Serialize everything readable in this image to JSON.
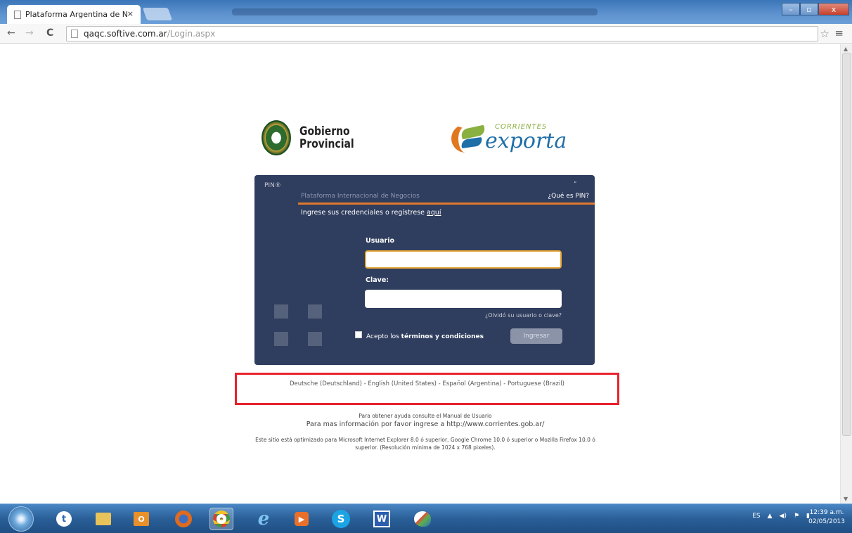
{
  "browser": {
    "tab_title": "Plataforma Argentina de N",
    "tab_close": "×",
    "url_host": "qaqc.softive.com.ar",
    "url_path": "/Login.aspx",
    "back_icon": "←",
    "forward_icon": "→",
    "reload_icon": "C",
    "star_icon": "☆",
    "menu_icon": "≡",
    "win_minimize": "–",
    "win_maximize": "▫",
    "win_close": "x"
  },
  "header": {
    "gobierno_line1": "Gobierno",
    "gobierno_line2": "Provincial",
    "corrientes_small": "CORRIENTES",
    "corrientes_big": "exporta",
    "brand_colors": {
      "orange": "#e07820",
      "green": "#8ab040",
      "blue": "#1e6ea8"
    }
  },
  "login": {
    "pin_label": "PIN®",
    "corner_mark": "\"",
    "platform_name": "Plataforma Internacional de Negocios",
    "what_is_pin": "¿Qué es PIN?",
    "intro_text": "Ingrese sus credenciales o regístrese",
    "intro_link": "aquí",
    "user_label": "Usuario",
    "user_value": "",
    "password_label": "Clave:",
    "password_value": "",
    "forgot_link": "¿Olvidó su usuario o clave?",
    "accept_prefix": "Acepto los",
    "accept_terms": "términos y condiciones",
    "submit_label": "Ingresar",
    "panel_color": "#2f3d5e",
    "accent_color": "#e07a2e"
  },
  "languages": {
    "text": "Deutsche (Deutschland) - English (United States) - Español (Argentina) - Portuguese (Brazil)",
    "highlight_color": "#e8222d"
  },
  "help": {
    "line1": "Para obtener ayuda consulte el Manual de Usuario",
    "line2": "Para mas información por favor ingrese a http://www.corrientes.gob.ar/",
    "line3": "Este sitio está optimizado para Microsoft Internet Explorer 8.0 ó superior, Google Chrome 10.0 ó superior o Mozilla Firefox 10.0 ó superior. (Resolución mínima de 1024 x 768 pixeles)."
  },
  "taskbar": {
    "icons": [
      "twitter-icon",
      "explorer-icon",
      "outlook-icon",
      "firefox-icon",
      "chrome-icon",
      "ie-icon",
      "media-icon",
      "skype-icon",
      "word-icon",
      "paint-icon"
    ],
    "language": "ES",
    "time": "12:39 a.m.",
    "date": "02/05/2013"
  }
}
